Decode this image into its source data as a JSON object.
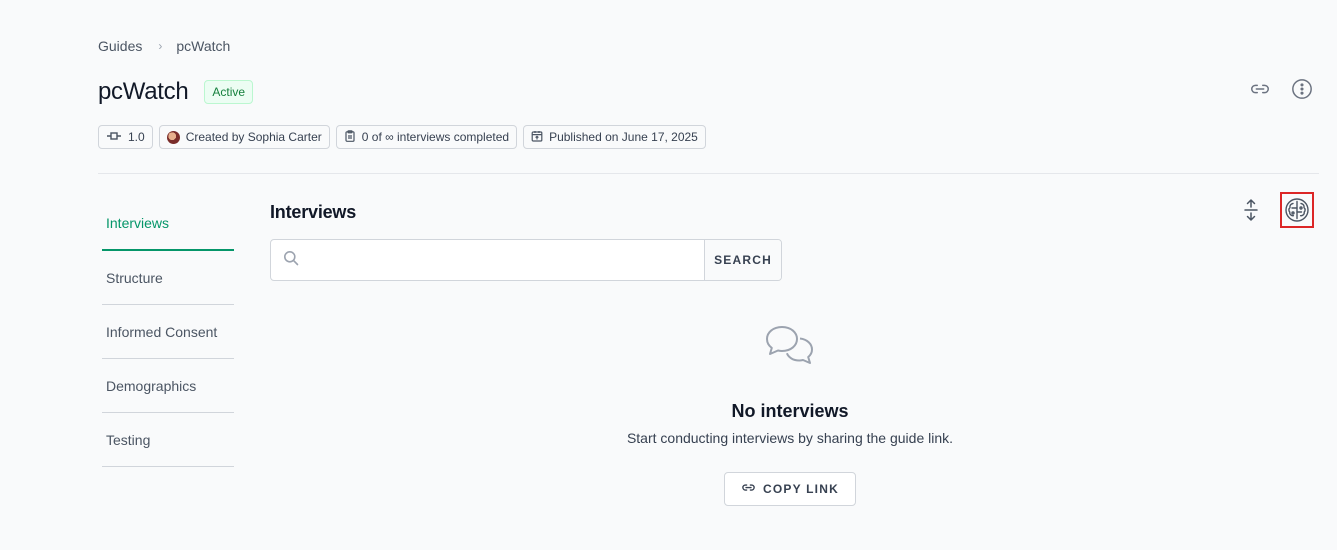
{
  "breadcrumb": {
    "items": [
      "Guides",
      "pcWatch"
    ],
    "separator": "›"
  },
  "header": {
    "title": "pcWatch",
    "status": "Active"
  },
  "meta": {
    "version": "1.0",
    "creator": "Created by Sophia Carter",
    "interviews": "0 of ∞ interviews completed",
    "published": "Published on June 17, 2025"
  },
  "nav": {
    "items": [
      "Interviews",
      "Structure",
      "Informed Consent",
      "Demographics",
      "Testing"
    ],
    "active": "Interviews"
  },
  "section": {
    "title": "Interviews"
  },
  "search": {
    "placeholder": "",
    "button_label": "SEARCH"
  },
  "empty": {
    "title": "No interviews",
    "description": "Start conducting interviews by sharing the guide link.",
    "button_label": "COPY LINK"
  },
  "icons": {
    "header_actions": [
      "link-icon",
      "more-options-icon"
    ],
    "section_actions": [
      "expand-collapse-icon",
      "ai-brain-icon"
    ]
  },
  "colors": {
    "accent": "#059669",
    "status_active": "#15803d",
    "highlight": "#dc2626"
  }
}
